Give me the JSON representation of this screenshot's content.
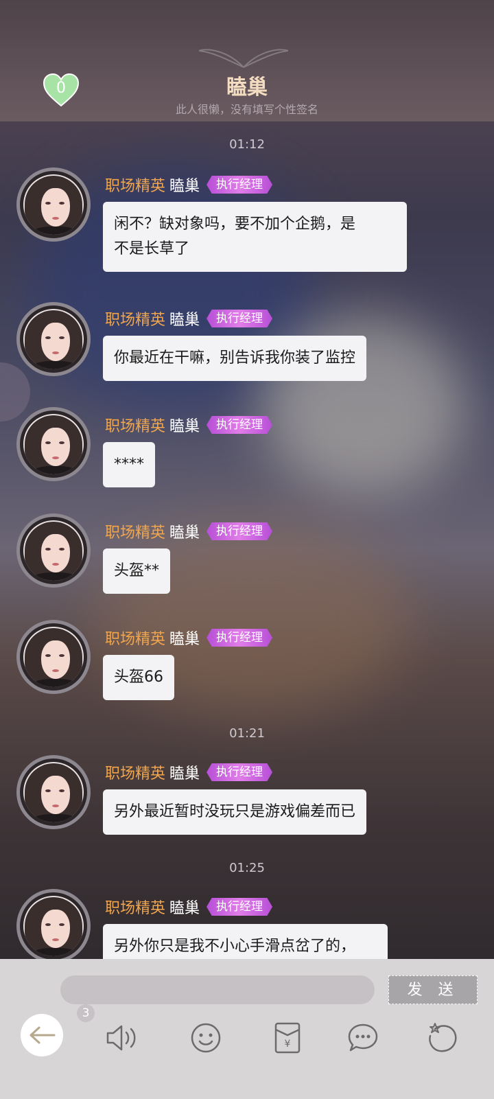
{
  "header": {
    "title": "瞌巢",
    "subtitle": "此人很懒，没有填写个性签名",
    "like_count": "0"
  },
  "messages": [
    {
      "timestamp": "01:12",
      "rank": "职场精英",
      "name": "瞌巢",
      "role": "执行经理",
      "text_lines": [
        "闲不？缺对象吗，要不加个企鹅，是",
        "不是长草了"
      ]
    },
    {
      "rank": "职场精英",
      "name": "瞌巢",
      "role": "执行经理",
      "text_lines": [
        "你最近在干嘛，别告诉我你装了监控"
      ]
    },
    {
      "rank": "职场精英",
      "name": "瞌巢",
      "role": "执行经理",
      "text_lines": [
        "****"
      ]
    },
    {
      "rank": "职场精英",
      "name": "瞌巢",
      "role": "执行经理",
      "text_lines": [
        "头盔**"
      ]
    },
    {
      "rank": "职场精英",
      "name": "瞌巢",
      "role": "执行经理",
      "text_lines": [
        "头盔66"
      ]
    },
    {
      "timestamp": "01:21",
      "rank": "职场精英",
      "name": "瞌巢",
      "role": "执行经理",
      "text_lines": [
        "另外最近暂时没玩只是游戏偏差而已"
      ]
    },
    {
      "timestamp": "01:25",
      "rank": "职场精英",
      "name": "瞌巢",
      "role": "执行经理",
      "text_lines": [
        "另外你只是我不小心手滑点岔了的，"
      ]
    }
  ],
  "input": {
    "placeholder": "",
    "send_label": "发 送"
  },
  "toolbar": {
    "back_badge": "3",
    "items": [
      "back-icon",
      "voice-icon",
      "emoji-icon",
      "red-packet-icon",
      "chat-bubble-icon",
      "refresh-icon"
    ]
  },
  "colors": {
    "rank": "#f1a64d",
    "role_badge": "#d06ee0",
    "title": "#f4dcc0",
    "heart": "#a6e3a4"
  }
}
